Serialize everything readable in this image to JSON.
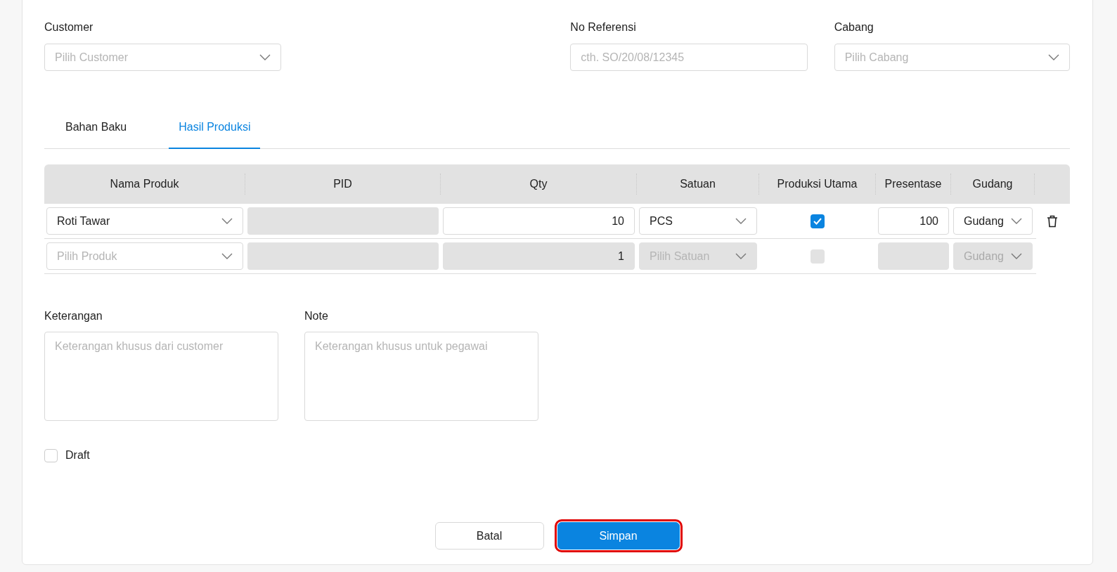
{
  "header_fields": [
    {
      "kind": "select",
      "label": "Customer",
      "placeholder": "Pilih Customer"
    },
    {
      "kind": "text",
      "label": "No Referensi",
      "placeholder": "cth. SO/20/08/12345"
    },
    {
      "kind": "select",
      "label": "Cabang",
      "placeholder": "Pilih Cabang"
    }
  ],
  "tabs": [
    {
      "label": "Bahan Baku",
      "selected": false
    },
    {
      "label": "Hasil Produksi",
      "selected": true
    }
  ],
  "table": {
    "columns": [
      "Nama Produk",
      "PID",
      "Qty",
      "Satuan",
      "Produksi Utama",
      "Presentase",
      "Gudang"
    ],
    "rows": [
      {
        "disabled": false,
        "produk": {
          "value": "Roti Tawar"
        },
        "qty": "10",
        "satuan": {
          "value": "PCS"
        },
        "produksi_utama": true,
        "presentase": "100",
        "gudang": "Gudang",
        "deletable": true
      },
      {
        "disabled": true,
        "produk": {
          "placeholder": "Pilih Produk"
        },
        "qty": "1",
        "satuan": {
          "placeholder": "Pilih Satuan"
        },
        "produksi_utama": false,
        "gudang": "Gudang",
        "deletable": false
      }
    ]
  },
  "notes": [
    {
      "label": "Keterangan",
      "placeholder": "Keterangan khusus dari customer"
    },
    {
      "label": "Note",
      "placeholder": "Keterangan khusus untuk pegawai"
    }
  ],
  "draft": {
    "label": "Draft",
    "checked": false
  },
  "buttons": [
    {
      "kind": "secondary",
      "label": "Batal",
      "highlighted": false
    },
    {
      "kind": "primary",
      "label": "Simpan",
      "highlighted": true
    }
  ]
}
